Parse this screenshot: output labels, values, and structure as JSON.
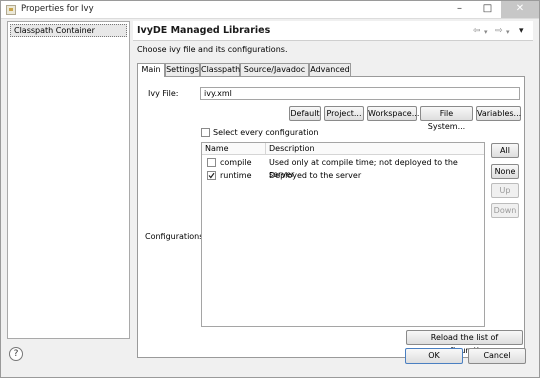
{
  "window": {
    "title": "Properties for Ivy",
    "minimize_glyph": "–",
    "maximize_glyph": "□",
    "close_glyph": "✕"
  },
  "sidebar": {
    "items": [
      {
        "label": "Classpath Container",
        "selected": true
      }
    ]
  },
  "page": {
    "title": "IvyDE Managed Libraries",
    "description": "Choose ivy file and its configurations.",
    "nav": {
      "back_glyph": "⇦",
      "forward_glyph": "⇨",
      "menu_glyph": "▾"
    }
  },
  "tabs": [
    {
      "label": "Main",
      "active": true
    },
    {
      "label": "Settings",
      "active": false
    },
    {
      "label": "Classpath",
      "active": false
    },
    {
      "label": "Source/Javadoc",
      "active": false
    },
    {
      "label": "Advanced",
      "active": false
    }
  ],
  "main_tab": {
    "ivy_file_label": "Ivy File:",
    "ivy_file_value": "ivy.xml",
    "buttons": {
      "default": "Default",
      "project": "Project...",
      "workspace": "Workspace...",
      "file_system": "File System...",
      "variables": "Variables..."
    },
    "select_every_configuration": {
      "label": "Select every configuration",
      "checked": false
    },
    "configurations_label": "Configurations",
    "table": {
      "columns": [
        "Name",
        "Description"
      ],
      "rows": [
        {
          "name": "compile",
          "description": "Used only at compile time; not deployed to the server",
          "checked": false
        },
        {
          "name": "runtime",
          "description": "Deployed to the server",
          "checked": true
        }
      ]
    },
    "side_buttons": {
      "all": "All",
      "none": "None",
      "up": "Up",
      "down": "Down"
    },
    "reload_button": "Reload the list of configurations"
  },
  "footer": {
    "help_glyph": "?",
    "ok": "OK",
    "cancel": "Cancel"
  },
  "colors": {
    "title_bar": "#ffffff",
    "window_bg": "#f0f0f0",
    "close_button": "#c7c7c7",
    "panel_bg": "#ffffff"
  },
  "icons": {
    "window": "properties-window-icon",
    "help": "help-icon",
    "back": "back-arrow-icon",
    "forward": "forward-arrow-icon",
    "view_menu": "view-menu-icon",
    "check": "checkmark-icon"
  }
}
